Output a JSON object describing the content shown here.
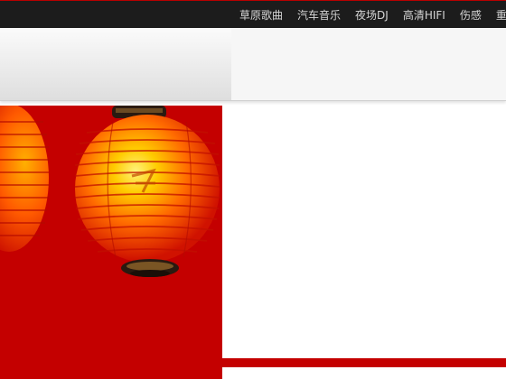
{
  "nav": {
    "items": [
      {
        "label": "草原歌曲"
      },
      {
        "label": "汽车音乐"
      },
      {
        "label": "夜场DJ"
      },
      {
        "label": "高清HIFI"
      },
      {
        "label": "伤感"
      },
      {
        "label": "重"
      }
    ]
  },
  "colors": {
    "topbar": "#1c1c1c",
    "accent_red": "#c40000",
    "nav_text": "#d6d6d6",
    "lantern_glow": "#ffd400"
  },
  "banner": {
    "icon": "red-lantern-image"
  }
}
